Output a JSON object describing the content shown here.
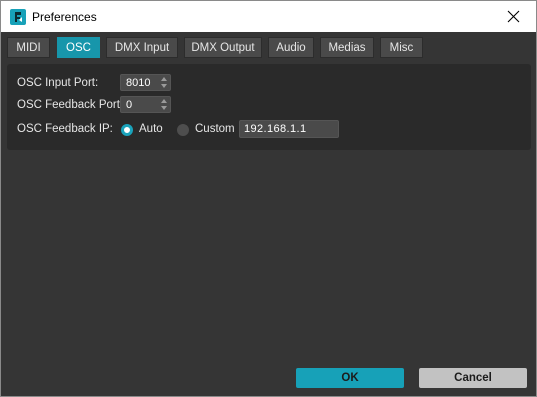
{
  "window": {
    "title": "Preferences"
  },
  "tabs": [
    {
      "label": "MIDI",
      "active": false
    },
    {
      "label": "OSC",
      "active": true
    },
    {
      "label": "DMX Input",
      "active": false
    },
    {
      "label": "DMX Output",
      "active": false
    },
    {
      "label": "Audio",
      "active": false
    },
    {
      "label": "Medias",
      "active": false
    },
    {
      "label": "Misc",
      "active": false
    }
  ],
  "osc": {
    "input_port_label": "OSC Input Port:",
    "input_port_value": "8010",
    "feedback_port_label": "OSC Feedback Port:",
    "feedback_port_value": "0",
    "feedback_ip_label": "OSC Feedback IP:",
    "auto_label": "Auto",
    "auto_selected": true,
    "custom_label": "Custom",
    "custom_selected": false,
    "custom_ip_value": "192.168.1.1"
  },
  "buttons": {
    "ok_label": "OK",
    "cancel_label": "Cancel"
  },
  "colors": {
    "accent": "#17a1b8",
    "background": "#353535",
    "panel": "#2a2a2a",
    "cancel": "#c2c2c2"
  },
  "icons": {
    "app": "app-logo-icon",
    "close": "close-icon",
    "spin_arrows": "spin-arrows-icon"
  }
}
